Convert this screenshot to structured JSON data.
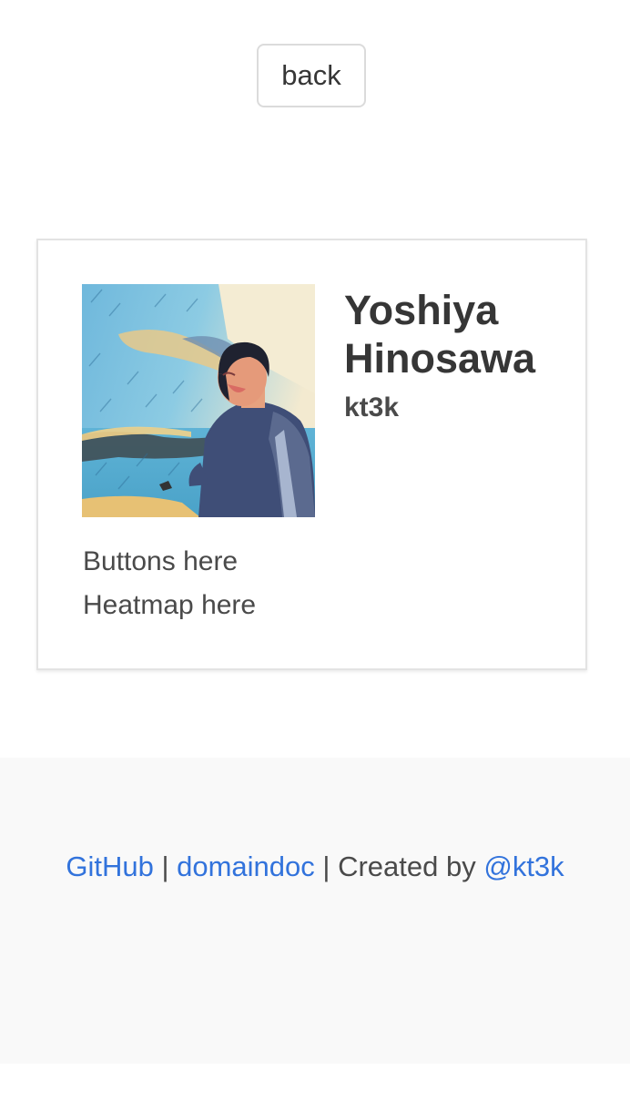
{
  "header": {
    "back_label": "back"
  },
  "profile": {
    "name": "Yoshiya Hinosawa",
    "username": "kt3k",
    "avatar_icon": "profile-photo",
    "buttons_placeholder": "Buttons here",
    "heatmap_placeholder": "Heatmap here"
  },
  "footer": {
    "github_link": "GitHub",
    "separator": "|",
    "domaindoc_link": "domaindoc",
    "created_by_text": "| Created by",
    "author_link": "@kt3k"
  },
  "colors": {
    "link": "#3273dc",
    "footer_bg": "#f9f9f9",
    "text": "#4a4a4a"
  }
}
